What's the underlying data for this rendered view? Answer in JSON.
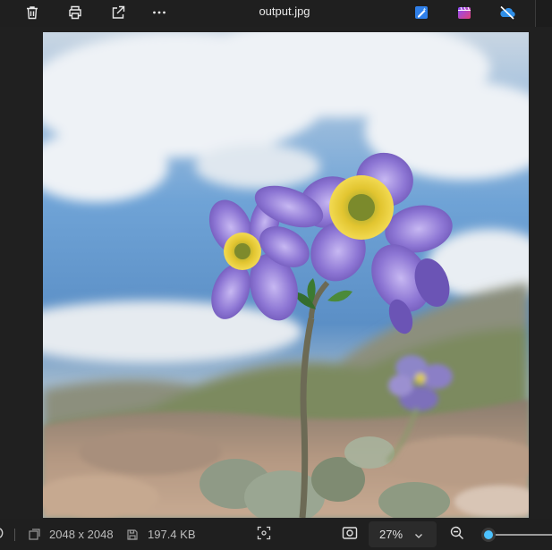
{
  "window": {
    "title": "output.jpg"
  },
  "toolbar": {
    "left_icons": [
      "delete-icon",
      "print-icon",
      "share-icon",
      "more-options-icon"
    ],
    "right_icons": [
      "edit-image-icon",
      "clipchamp-icon",
      "onedrive-icon"
    ]
  },
  "status": {
    "dimensions": "2048 x 2048",
    "file_size": "197.4 KB",
    "zoom": "27%",
    "zoom_level": 0.27
  },
  "colors": {
    "accent": "#4cc2ff",
    "background": "#202020"
  }
}
